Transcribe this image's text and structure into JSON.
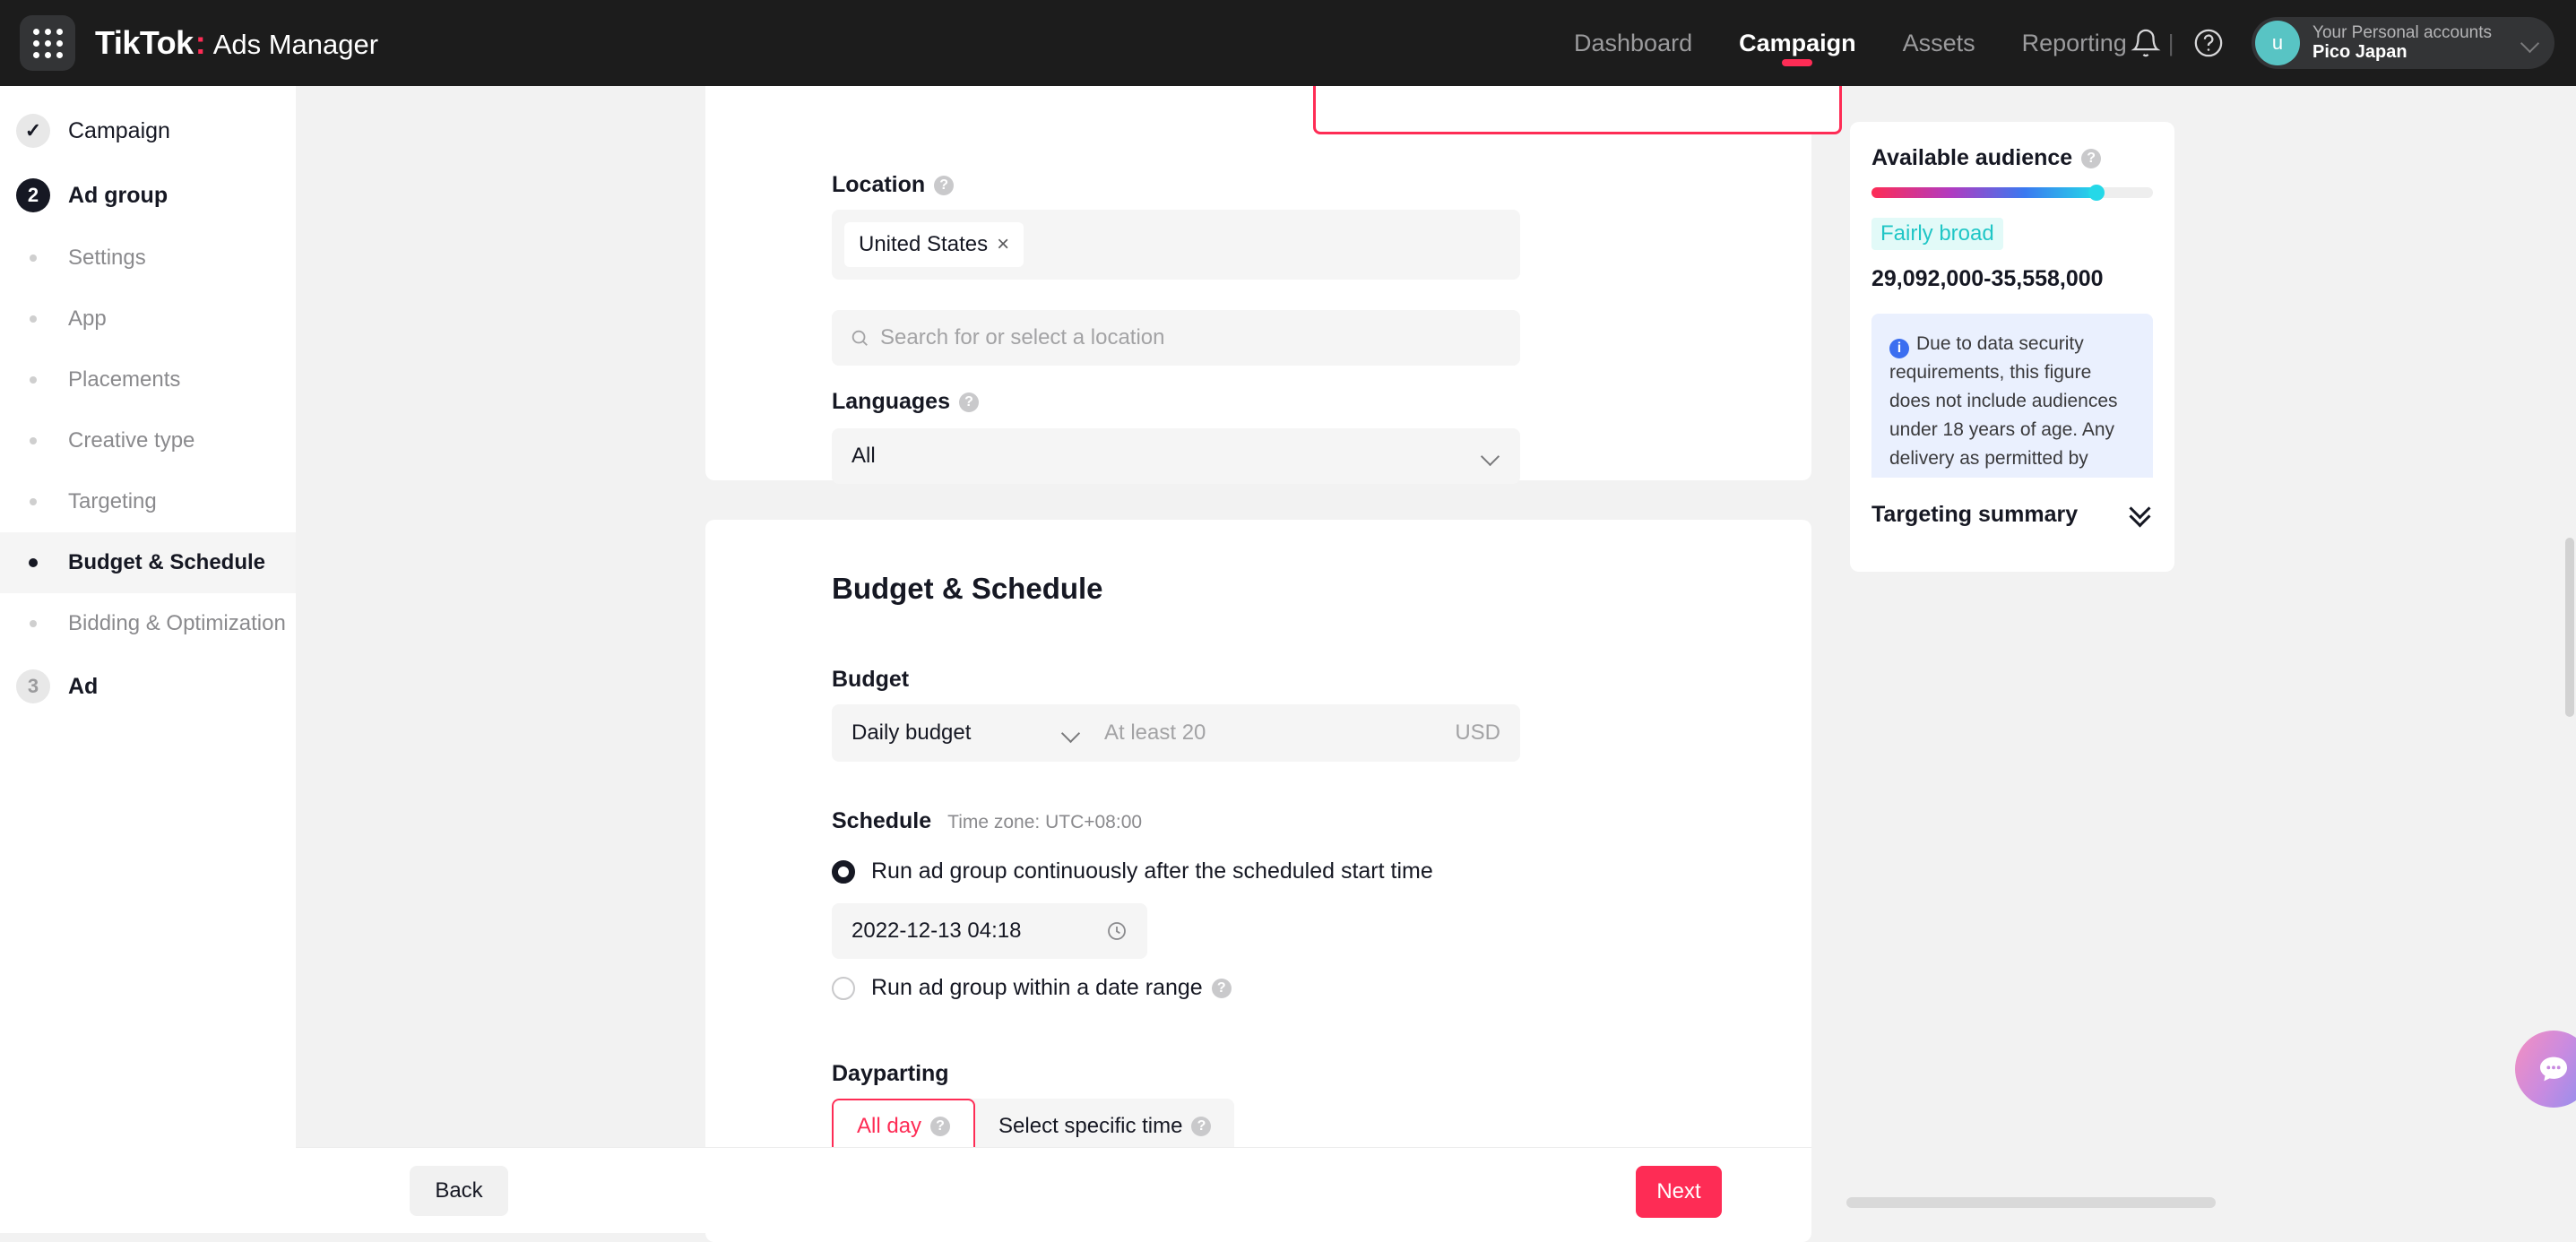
{
  "topbar": {
    "grid_icon": "grid-apps-icon",
    "brand_name": "TikTok",
    "brand_colon": ":",
    "brand_product": "Ads Manager",
    "nav": [
      {
        "label": "Dashboard",
        "active": false
      },
      {
        "label": "Campaign",
        "active": true
      },
      {
        "label": "Assets",
        "active": false
      },
      {
        "label": "Reporting",
        "active": false
      }
    ],
    "nav_divider": "|",
    "bell_icon": "notification-bell-icon",
    "help_icon": "help-circle-icon",
    "account": {
      "avatar_initial": "u",
      "label": "Your Personal accounts",
      "name": "Pico Japan",
      "chevron_icon": "chevron-down-icon"
    }
  },
  "sidebar": {
    "steps": [
      {
        "badge": "✓",
        "label": "Campaign",
        "state": "done"
      },
      {
        "badge": "2",
        "label": "Ad group",
        "state": "current"
      },
      {
        "badge": "3",
        "label": "Ad",
        "state": "todo"
      }
    ],
    "sub_items": [
      {
        "label": "Settings",
        "active": false
      },
      {
        "label": "App",
        "active": false
      },
      {
        "label": "Placements",
        "active": false
      },
      {
        "label": "Creative type",
        "active": false
      },
      {
        "label": "Targeting",
        "active": false
      },
      {
        "label": "Budget & Schedule",
        "active": true
      },
      {
        "label": "Bidding & Optimization",
        "active": false
      }
    ]
  },
  "targeting": {
    "location": {
      "label": "Location",
      "help_icon": "help-icon",
      "tags": [
        {
          "name": "United States",
          "remove_icon": "×"
        }
      ],
      "search_placeholder": "Search for or select a location",
      "search_icon": "search-icon"
    },
    "languages": {
      "label": "Languages",
      "help_icon": "help-icon",
      "value": "All",
      "chevron_icon": "chevron-down-icon"
    }
  },
  "budget_schedule": {
    "section_title": "Budget & Schedule",
    "budget": {
      "label": "Budget",
      "type_value": "Daily budget",
      "type_chevron_icon": "chevron-down-icon",
      "amount_placeholder": "At least 20",
      "currency": "USD"
    },
    "schedule": {
      "label": "Schedule",
      "timezone": "Time zone: UTC+08:00",
      "options": [
        {
          "label": "Run ad group continuously after the scheduled start time",
          "selected": true
        },
        {
          "label": "Run ad group within a date range",
          "selected": false,
          "help_icon": "help-icon"
        }
      ],
      "start_datetime": "2022-12-13 04:18",
      "clock_icon": "clock-icon"
    },
    "dayparting": {
      "label": "Dayparting",
      "options": [
        {
          "label": "All day",
          "active": true,
          "help_icon": "help-icon"
        },
        {
          "label": "Select specific time",
          "active": false,
          "help_icon": "help-icon"
        }
      ]
    }
  },
  "footer": {
    "back_label": "Back",
    "next_label": "Next"
  },
  "right_panel": {
    "audience": {
      "title": "Available audience",
      "help_icon": "help-icon",
      "meter_percent": 80,
      "badge": "Fairly broad",
      "range": "29,092,000-35,558,000",
      "notice_icon": "info-icon",
      "notice": "Due to data security requirements, this figure does not include audiences under 18 years of age. Any delivery as permitted by applicable laws will not be affected."
    },
    "targeting_summary": {
      "title": "Targeting summary",
      "expand_icon": "double-chevron-down-icon"
    }
  },
  "chat": {
    "icon": "chat-bubble-icon"
  },
  "colors": {
    "accent_pink": "#fe2c55",
    "topbar_bg": "#1c1c1c",
    "teal": "#20c6c6",
    "info_blue": "#3b6ef0"
  }
}
